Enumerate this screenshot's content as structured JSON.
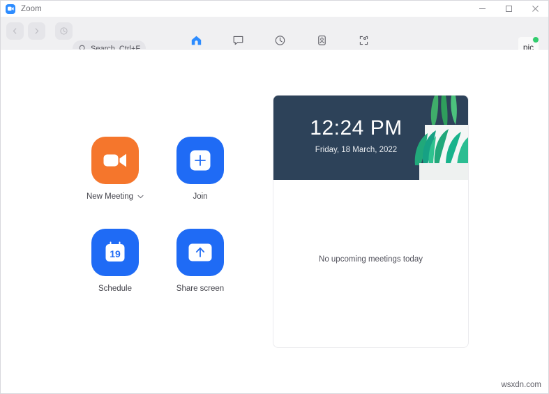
{
  "window": {
    "title": "Zoom",
    "logo_icon": "zoom-video-logo-icon",
    "controls": {
      "minimize_icon": "minimize-icon",
      "maximize_icon": "maximize-icon",
      "close_icon": "close-icon"
    }
  },
  "toolbar": {
    "nav": {
      "back_icon": "chevron-left-icon",
      "forward_icon": "chevron-right-icon",
      "history_icon": "history-clock-icon"
    },
    "search": {
      "icon": "search-icon",
      "label": "Search",
      "shortcut": "Ctrl+F"
    },
    "tabs": [
      {
        "label": "Home",
        "icon": "home-icon",
        "active": true
      },
      {
        "label": "Chat",
        "icon": "chat-bubble-icon",
        "active": false
      },
      {
        "label": "Meetings",
        "icon": "clock-icon",
        "active": false
      },
      {
        "label": "Contacts",
        "icon": "contacts-person-icon",
        "active": false
      },
      {
        "label": "Apps",
        "icon": "apps-grid-icon",
        "active": false
      }
    ],
    "avatar": {
      "label": "pic",
      "presence": "available",
      "presence_color": "#32cd6e"
    }
  },
  "settings": {
    "icon": "gear-icon",
    "highlight_color": "#e02020"
  },
  "actions": [
    {
      "label": "New Meeting",
      "icon": "video-camera-icon",
      "tile_color": "#f5762c",
      "has_dropdown": true,
      "dropdown_icon": "chevron-down-icon"
    },
    {
      "label": "Join",
      "icon": "plus-icon",
      "tile_color": "#1f6bf5",
      "has_dropdown": false
    },
    {
      "label": "Schedule",
      "icon": "calendar-icon",
      "calendar_day": "19",
      "tile_color": "#1f6bf5",
      "has_dropdown": false
    },
    {
      "label": "Share screen",
      "icon": "share-screen-up-arrow-icon",
      "tile_color": "#1f6bf5",
      "has_dropdown": false
    }
  ],
  "panel": {
    "clock": {
      "time": "12:24 PM",
      "date": "Friday, 18 March, 2022",
      "background_color": "#2d4259",
      "illustration": "potted-plant-illustration"
    },
    "empty_state": "No upcoming meetings today"
  },
  "watermark": "wsxdn.com"
}
